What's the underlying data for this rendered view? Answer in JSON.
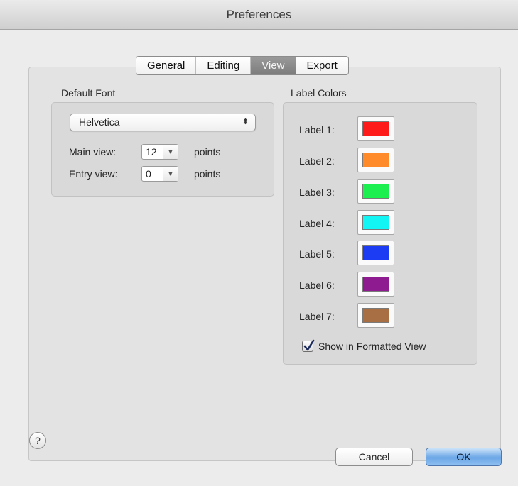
{
  "window": {
    "title": "Preferences"
  },
  "tabs": [
    {
      "label": "General",
      "active": false
    },
    {
      "label": "Editing",
      "active": false
    },
    {
      "label": "View",
      "active": true
    },
    {
      "label": "Export",
      "active": false
    }
  ],
  "default_font": {
    "title": "Default Font",
    "font_popup": "Helvetica",
    "main_view": {
      "label": "Main view:",
      "value": "12",
      "unit": "points"
    },
    "entry_view": {
      "label": "Entry view:",
      "value": "0",
      "unit": "points"
    }
  },
  "label_colors": {
    "title": "Label Colors",
    "items": [
      {
        "label": "Label 1:",
        "color": "#ff1a1a"
      },
      {
        "label": "Label 2:",
        "color": "#ff8a2a"
      },
      {
        "label": "Label 3:",
        "color": "#1aef4f"
      },
      {
        "label": "Label 4:",
        "color": "#13f5f5"
      },
      {
        "label": "Label 5:",
        "color": "#1b3cf2"
      },
      {
        "label": "Label 6:",
        "color": "#8e1b90"
      },
      {
        "label": "Label 7:",
        "color": "#a86f45"
      }
    ],
    "show_formatted": {
      "label": "Show in Formatted View",
      "checked": true
    }
  },
  "footer": {
    "help": "?",
    "cancel": "Cancel",
    "ok": "OK"
  }
}
